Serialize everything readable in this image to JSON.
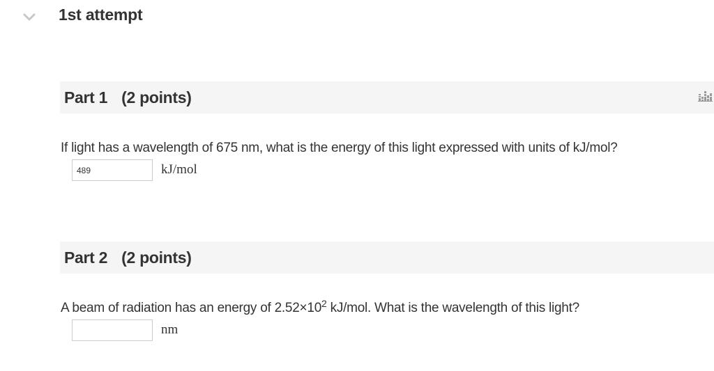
{
  "attempt": {
    "title": "1st attempt",
    "toggle_icon": "chevron-down-icon"
  },
  "parts": [
    {
      "title": "Part 1",
      "points": "(2 points)",
      "stats_icon": "bar-chart-icon",
      "question": "If light has a wavelength of 675 nm, what is the energy of this light expressed with units of kJ/mol?",
      "answer_value": "489",
      "unit": "kJ/mol"
    },
    {
      "title": "Part 2",
      "points": "(2 points)",
      "question_prefix": "A beam of radiation has an energy of 2.52×10",
      "question_exponent": "2",
      "question_suffix": " kJ/mol. What is the wavelength of this light?",
      "answer_value": "",
      "unit": "nm"
    }
  ],
  "colors": {
    "header_bg": "#f5f5f5",
    "text": "#333333",
    "input_border": "#cccccc",
    "icon_gray": "#c8c8c8"
  }
}
